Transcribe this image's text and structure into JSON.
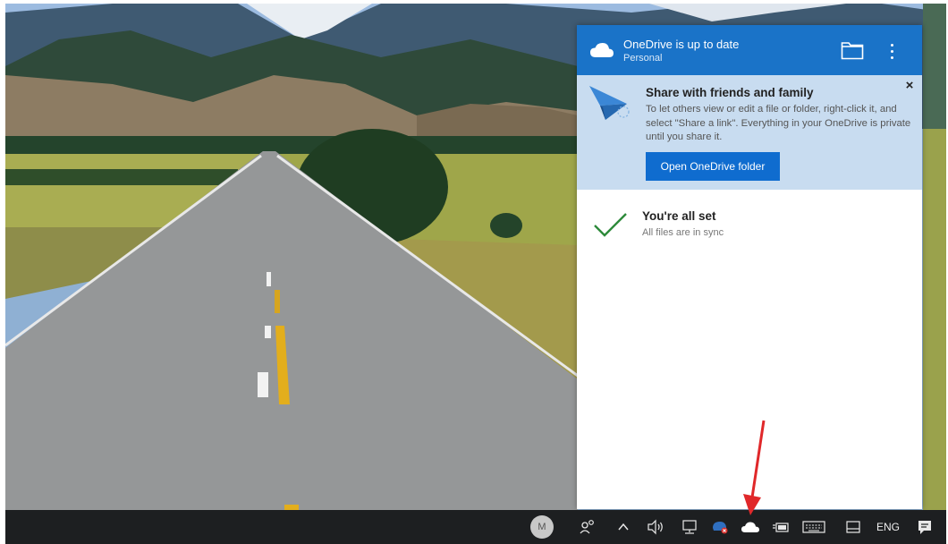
{
  "onedrive": {
    "status_title": "OneDrive is up to date",
    "account": "Personal",
    "share_title": "Share with friends and family",
    "share_description": "To let others view or edit a file or folder, right-click it, and select \"Share a link\". Everything in your OneDrive is private until you share it.",
    "close_symbol": "×",
    "open_folder_label": "Open OneDrive folder",
    "sync_title": "You're all set",
    "sync_subtitle": "All files are in sync"
  },
  "taskbar": {
    "avatar_initial": "M",
    "language": "ENG"
  },
  "icons": {
    "header": [
      "cloud-icon",
      "folder-icon",
      "more-options-icon"
    ],
    "banner": [
      "paper-plane-icon",
      "close-icon"
    ],
    "status": [
      "checkmark-icon"
    ],
    "tray": [
      "people-icon",
      "chevron-up-icon",
      "volume-icon",
      "network-icon",
      "defender-icon",
      "onedrive-cloud-icon",
      "battery-icon",
      "keyboard-icon",
      "tablet-mode-icon",
      "action-center-icon"
    ]
  },
  "colors": {
    "header_blue": "#1a73c8",
    "banner_blue": "#c8dcf0",
    "button_blue": "#0f6ccf",
    "check_green": "#2d8a3a",
    "taskbar": "#1d1f21",
    "annotation_arrow": "#e0282a"
  }
}
